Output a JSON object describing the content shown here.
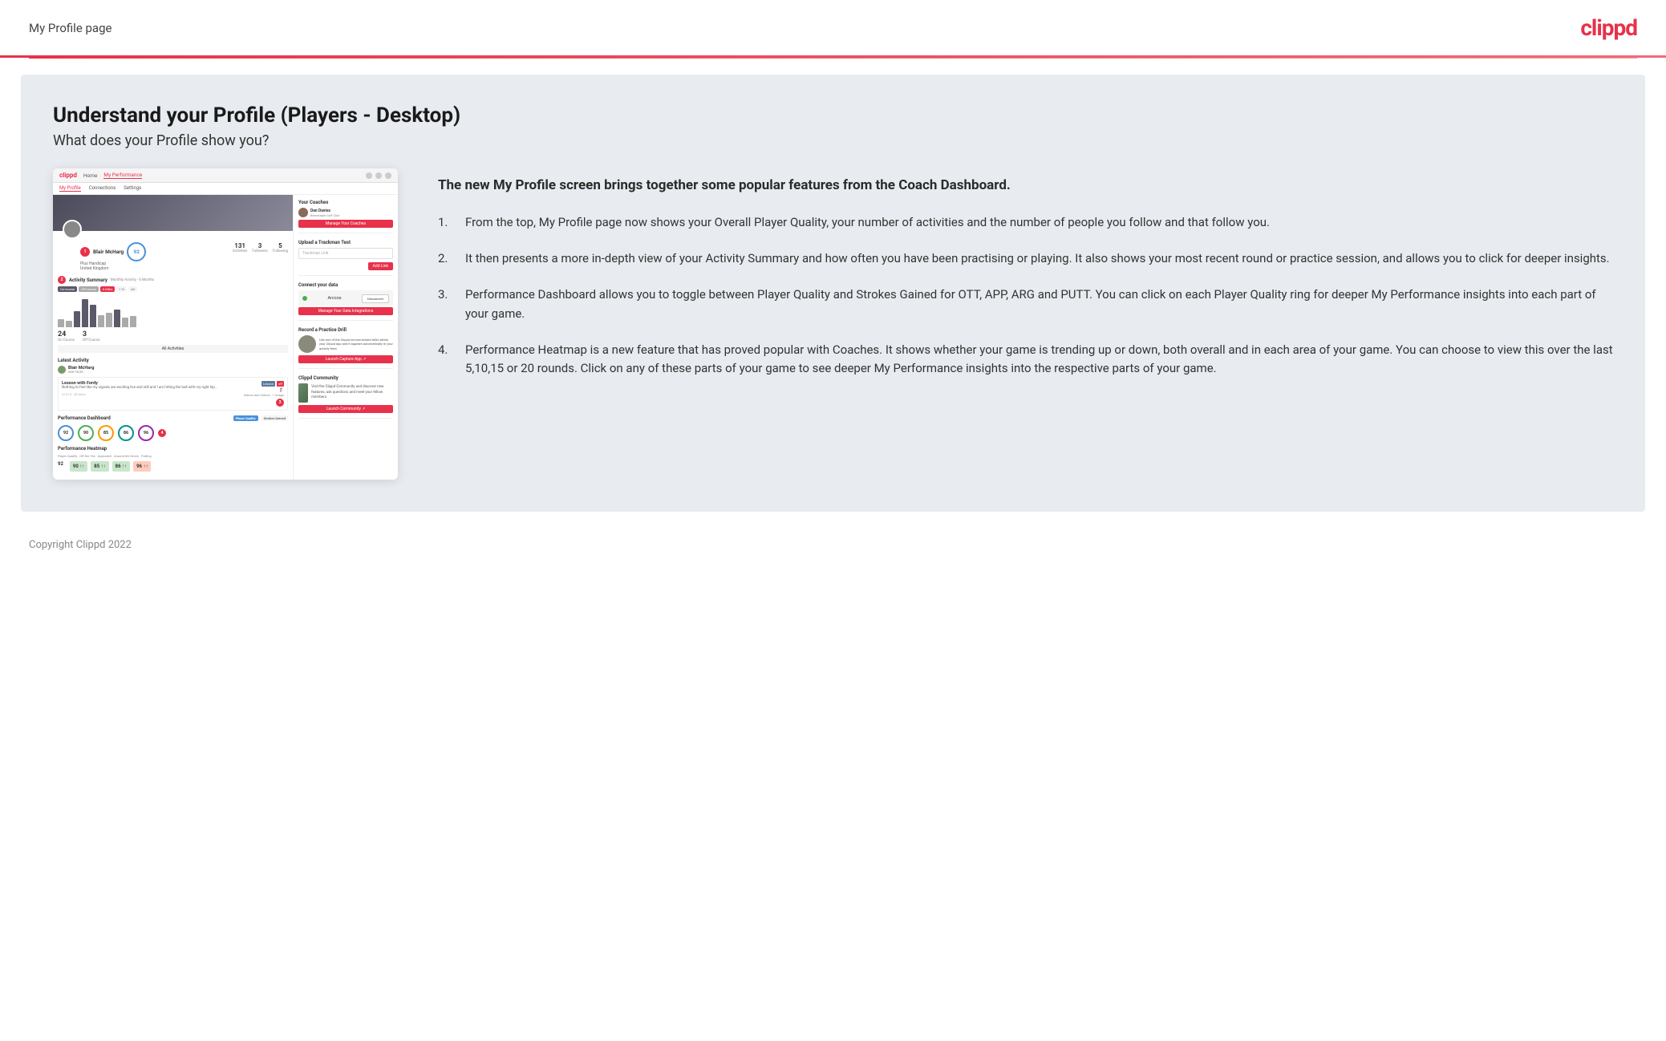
{
  "header": {
    "title": "My Profile page",
    "logo": "clippd"
  },
  "main": {
    "heading": "Understand your Profile (Players - Desktop)",
    "subheading": "What does your Profile show you?",
    "intro_bold": "The new My Profile screen brings together some popular features from the Coach Dashboard.",
    "list_items": [
      {
        "num": "1.",
        "text": "From the top, My Profile page now shows your Overall Player Quality, your number of activities and the number of people you follow and that follow you."
      },
      {
        "num": "2.",
        "text": "It then presents a more in-depth view of your Activity Summary and how often you have been practising or playing. It also shows your most recent round or practice session, and allows you to click for deeper insights."
      },
      {
        "num": "3.",
        "text": "Performance Dashboard allows you to toggle between Player Quality and Strokes Gained for OTT, APP, ARG and PUTT. You can click on each Player Quality ring for deeper My Performance insights into each part of your game."
      },
      {
        "num": "4.",
        "text": "Performance Heatmap is a new feature that has proved popular with Coaches. It shows whether your game is trending up or down, both overall and in each area of your game. You can choose to view this over the last 5,10,15 or 20 rounds. Click on any of these parts of your game to see deeper My Performance insights into the respective parts of your game."
      }
    ]
  },
  "mockup": {
    "nav": {
      "logo": "clippd",
      "items": [
        "Home",
        "My Performance"
      ]
    },
    "subnav": {
      "items": [
        "My Profile",
        "Connections",
        "Settings"
      ]
    },
    "player": {
      "name": "Blair McHarg",
      "handicap": "Plus Handicap",
      "location": "United Kingdom",
      "quality": "92",
      "activities": "131",
      "followers": "3",
      "following": "5"
    },
    "activity": {
      "title": "Activity Summary",
      "on_course": "24",
      "off_course": "3"
    },
    "performance": {
      "title": "Performance Dashboard",
      "rings": [
        {
          "value": "92",
          "color": "blue"
        },
        {
          "value": "90",
          "color": "green"
        },
        {
          "value": "85",
          "color": "orange"
        },
        {
          "value": "86",
          "color": "teal"
        },
        {
          "value": "96",
          "color": "purple"
        }
      ]
    },
    "heatmap": {
      "title": "Performance Heatmap",
      "cells": [
        {
          "label": "Player Quality",
          "value": "92"
        },
        {
          "label": "Off the Tee",
          "value": "90 ↑↑"
        },
        {
          "label": "Approach",
          "value": "85 ↑↑"
        },
        {
          "label": "Around the Green",
          "value": "86 ↑↑"
        },
        {
          "label": "Putting",
          "value": "96 ↑↑"
        }
      ]
    },
    "right_panel": {
      "coaches": {
        "title": "Your Coaches",
        "coach_name": "Dan Davies",
        "coach_club": "Barnstaple Golf Club",
        "btn_label": "Manage Your Coaches"
      },
      "trackman": {
        "title": "Upload a Trackman Test",
        "placeholder": "Trackman Link",
        "btn_label": "Add Link"
      },
      "connect": {
        "title": "Connect your data",
        "app_name": "Arccos",
        "connected_label": "Arccos",
        "manage_btn": "Manage Your Data Integrations"
      },
      "practice_drill": {
        "title": "Record a Practice Drill",
        "description": "Use one of the Clippd recommended drills within your Clippd app and it appears automatically in your activity feed.",
        "btn_label": "Launch Capture App ↗"
      },
      "community": {
        "title": "Clippd Community",
        "description": "Visit the Clippd Community and discover new features, ask questions and meet your fellow members.",
        "btn_label": "Launch Community ↗"
      }
    }
  },
  "footer": {
    "copyright": "Copyright Clippd 2022"
  }
}
